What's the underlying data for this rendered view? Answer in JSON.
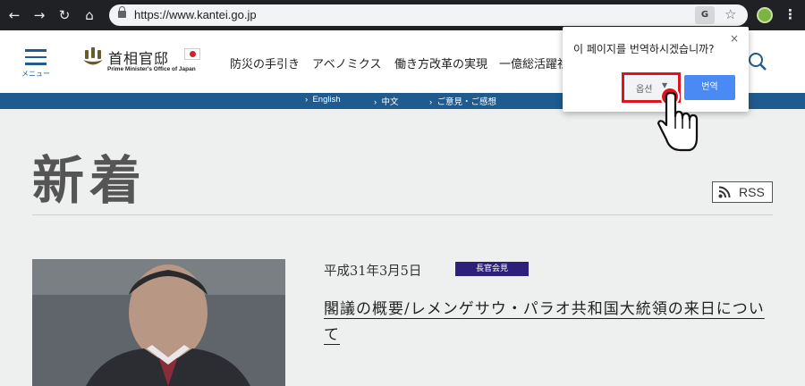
{
  "browser": {
    "url": "https://www.kantei.go.jp",
    "translate_icon_label": "G",
    "icons": [
      "back-icon",
      "forward-icon",
      "reload-icon",
      "home-icon",
      "lock-icon",
      "translate-icon",
      "star-icon",
      "extension-icon",
      "kebab-icon"
    ]
  },
  "header": {
    "menu_label": "メニュー",
    "logo_jp": "首相官邸",
    "logo_en": "Prime Minister's Office of Japan",
    "nav": [
      "防災の手引き",
      "アベノミクス",
      "働き方改革の実現",
      "一億総活躍社"
    ]
  },
  "langbar": {
    "items": [
      "English",
      "中文",
      "ご意見・ご感想"
    ]
  },
  "main": {
    "title": "新着",
    "rss_label": "RSS",
    "article": {
      "date": "平成31年3月5日",
      "category": "長官会見",
      "headline": "閣議の概要/レメンゲサウ・パラオ共和国大統領の来日について"
    }
  },
  "translate_popup": {
    "question": "이 페이지를 번역하시겠습니까?",
    "close_label": "×",
    "options_label": "옵션",
    "translate_label": "번역"
  },
  "colors": {
    "brand_blue": "#1f5b8e",
    "badge_purple": "#2d1f7a",
    "translate_button": "#4a8af4",
    "highlight_red": "#e0141c"
  }
}
